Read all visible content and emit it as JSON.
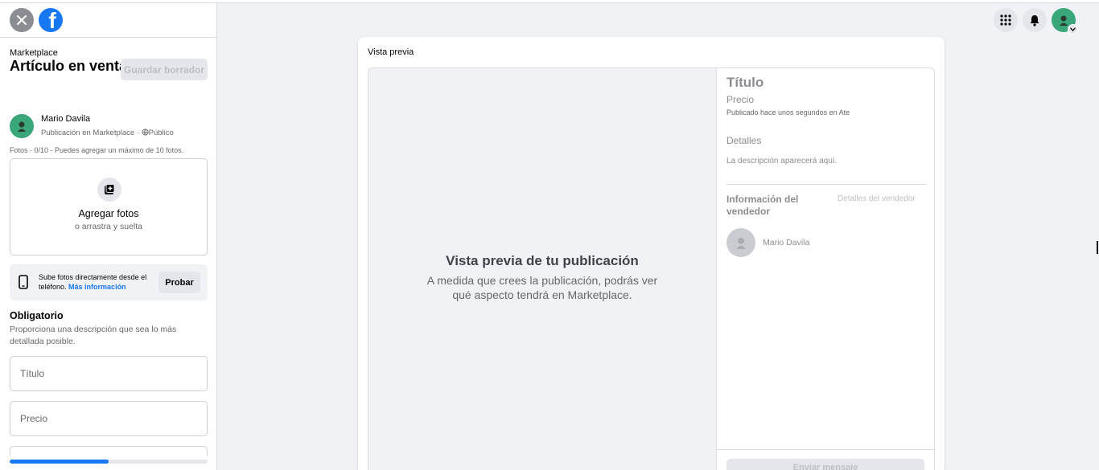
{
  "sidebar": {
    "breadcrumb": "Marketplace",
    "title": "Artículo en venta",
    "draft_button": "Guardar borrador",
    "user": {
      "name": "Mario Davila",
      "subtitle": "Publicación en Marketplace · ",
      "audience": "Público"
    },
    "photos_note": "Fotos · 0/10 - Puedes agregar un máximo de 10 fotos.",
    "photo_box": {
      "title": "Agregar fotos",
      "subtitle": "o arrastra y suelta"
    },
    "phone_promo": {
      "text": "Sube fotos directamente desde el teléfono.",
      "link": "Más información",
      "button": "Probar"
    },
    "required": {
      "title": "Obligatorio",
      "description": "Proporciona una descripción que sea lo más detallada posible."
    },
    "fields": {
      "title_placeholder": "Título",
      "price_placeholder": "Precio"
    },
    "progress_fraction": 0.5
  },
  "preview": {
    "label": "Vista previa",
    "left": {
      "title": "Vista previa de tu publicación",
      "description": "A medida que crees la publicación, podrás ver qué aspecto tendrá en Marketplace."
    },
    "right": {
      "title": "Título",
      "price": "Precio",
      "posted": "Publicado hace unos segundos en Ate",
      "details_label": "Detalles",
      "description_placeholder": "La descripción aparecerá aquí.",
      "seller_info": "Información del vendedor",
      "seller_details_link": "Detalles del vendedor",
      "seller_name": "Mario Davila",
      "send_button": "Enviar mensaje"
    }
  },
  "colors": {
    "accent": "#1877f2",
    "avatar": "#3aa77a",
    "background": "#f0f2f5"
  },
  "icons": {
    "close": "close-icon",
    "logo": "facebook-logo-icon",
    "menu": "grid-menu-icon",
    "notifications": "bell-icon",
    "add_photo": "add-photo-icon",
    "phone": "phone-icon",
    "globe": "globe-icon"
  }
}
